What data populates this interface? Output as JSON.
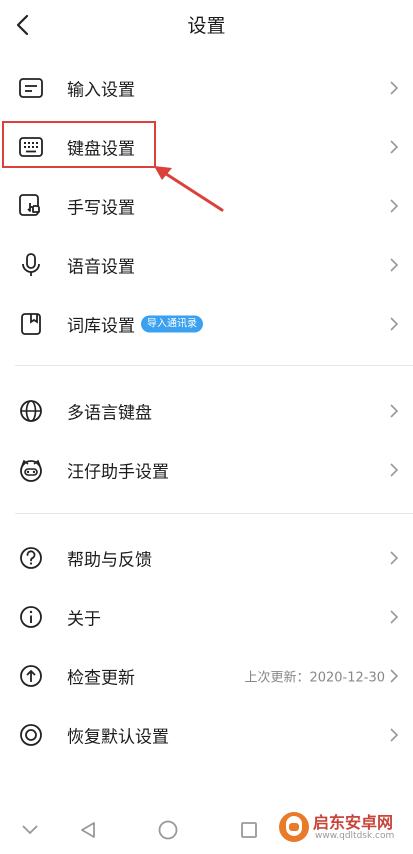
{
  "header": {
    "title": "设置"
  },
  "groups": [
    {
      "items": [
        {
          "label": "输入设置",
          "icon": "input-settings-icon"
        },
        {
          "label": "键盘设置",
          "icon": "keyboard-icon"
        },
        {
          "label": "手写设置",
          "icon": "handwriting-icon"
        },
        {
          "label": "语音设置",
          "icon": "microphone-icon"
        },
        {
          "label": "词库设置",
          "icon": "dictionary-icon",
          "badge": "导入通讯录"
        }
      ]
    },
    {
      "items": [
        {
          "label": "多语言键盘",
          "icon": "globe-icon"
        },
        {
          "label": "汪仔助手设置",
          "icon": "mascot-icon"
        }
      ]
    },
    {
      "items": [
        {
          "label": "帮助与反馈",
          "icon": "help-icon"
        },
        {
          "label": "关于",
          "icon": "info-icon"
        },
        {
          "label": "检查更新",
          "icon": "update-icon",
          "value": "上次更新：2020-12-30"
        },
        {
          "label": "恢复默认设置",
          "icon": "restore-icon"
        }
      ]
    }
  ],
  "watermark": {
    "text": "启东安卓网",
    "url": "www.qdltdsk.com"
  },
  "colors": {
    "accent": "#3aa0f0",
    "highlight": "#d9413a",
    "watermark": "#c8453a"
  }
}
